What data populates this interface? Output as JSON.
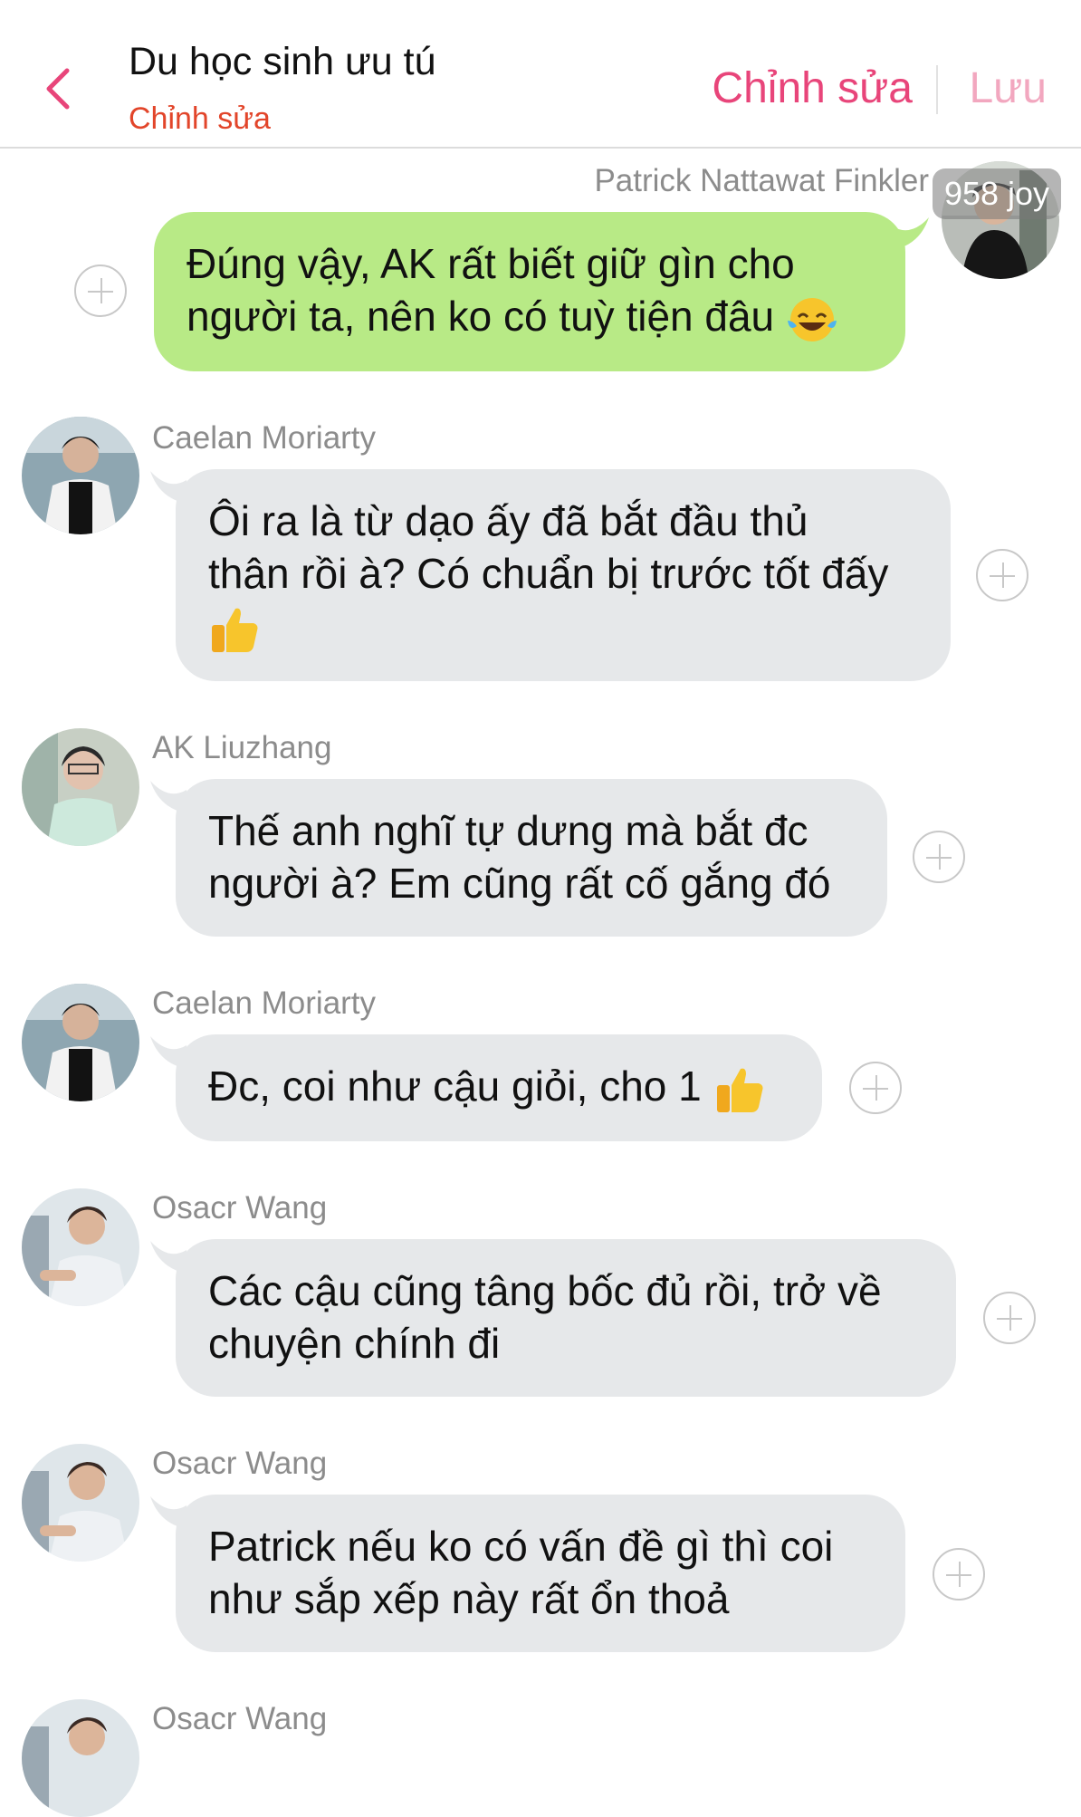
{
  "header": {
    "title": "Du học sinh ưu tú",
    "subtitle": "Chỉnh sửa",
    "edit_label": "Chỉnh sửa",
    "save_label": "Lưu",
    "back_icon": "chevron-left-icon"
  },
  "colors": {
    "accent": "#e8457a",
    "subtitle": "#e2452a",
    "outgoing_bubble": "#b8ea86",
    "incoming_bubble": "#e6e8ea"
  },
  "outgoing_message": {
    "sender": "Patrick Nattawat Finkler",
    "badge": "958 joy",
    "line1": "Đúng vậy, AK rất biết giữ gìn cho",
    "line2": "người ta, nên ko có tuỳ tiện đâu",
    "emoji": "face-with-tears-of-joy"
  },
  "messages": [
    {
      "sender": "Caelan Moriarty",
      "line1": "Ôi ra là từ dạo ấy đã bắt đầu thủ",
      "line2": "thân rồi à? Có chuẩn bị trước tốt đấy",
      "emoji": "thumbs-up"
    },
    {
      "sender": "AK Liuzhang",
      "line1": "Thế anh nghĩ tự dưng mà bắt đc",
      "line2": "người à? Em cũng rất cố gắng đó"
    },
    {
      "sender": "Caelan Moriarty",
      "line1": "Đc, coi như cậu giỏi, cho 1",
      "emoji": "thumbs-up"
    },
    {
      "sender": "Osacr Wang",
      "line1": "Các cậu cũng tâng bốc đủ rồi, trở về",
      "line2": "chuyện chính đi"
    },
    {
      "sender": "Osacr Wang",
      "line1": "Patrick nếu ko có vấn đề gì thì coi",
      "line2": "như sắp xếp này rất ổn thoả"
    },
    {
      "sender": "Osacr Wang"
    }
  ]
}
